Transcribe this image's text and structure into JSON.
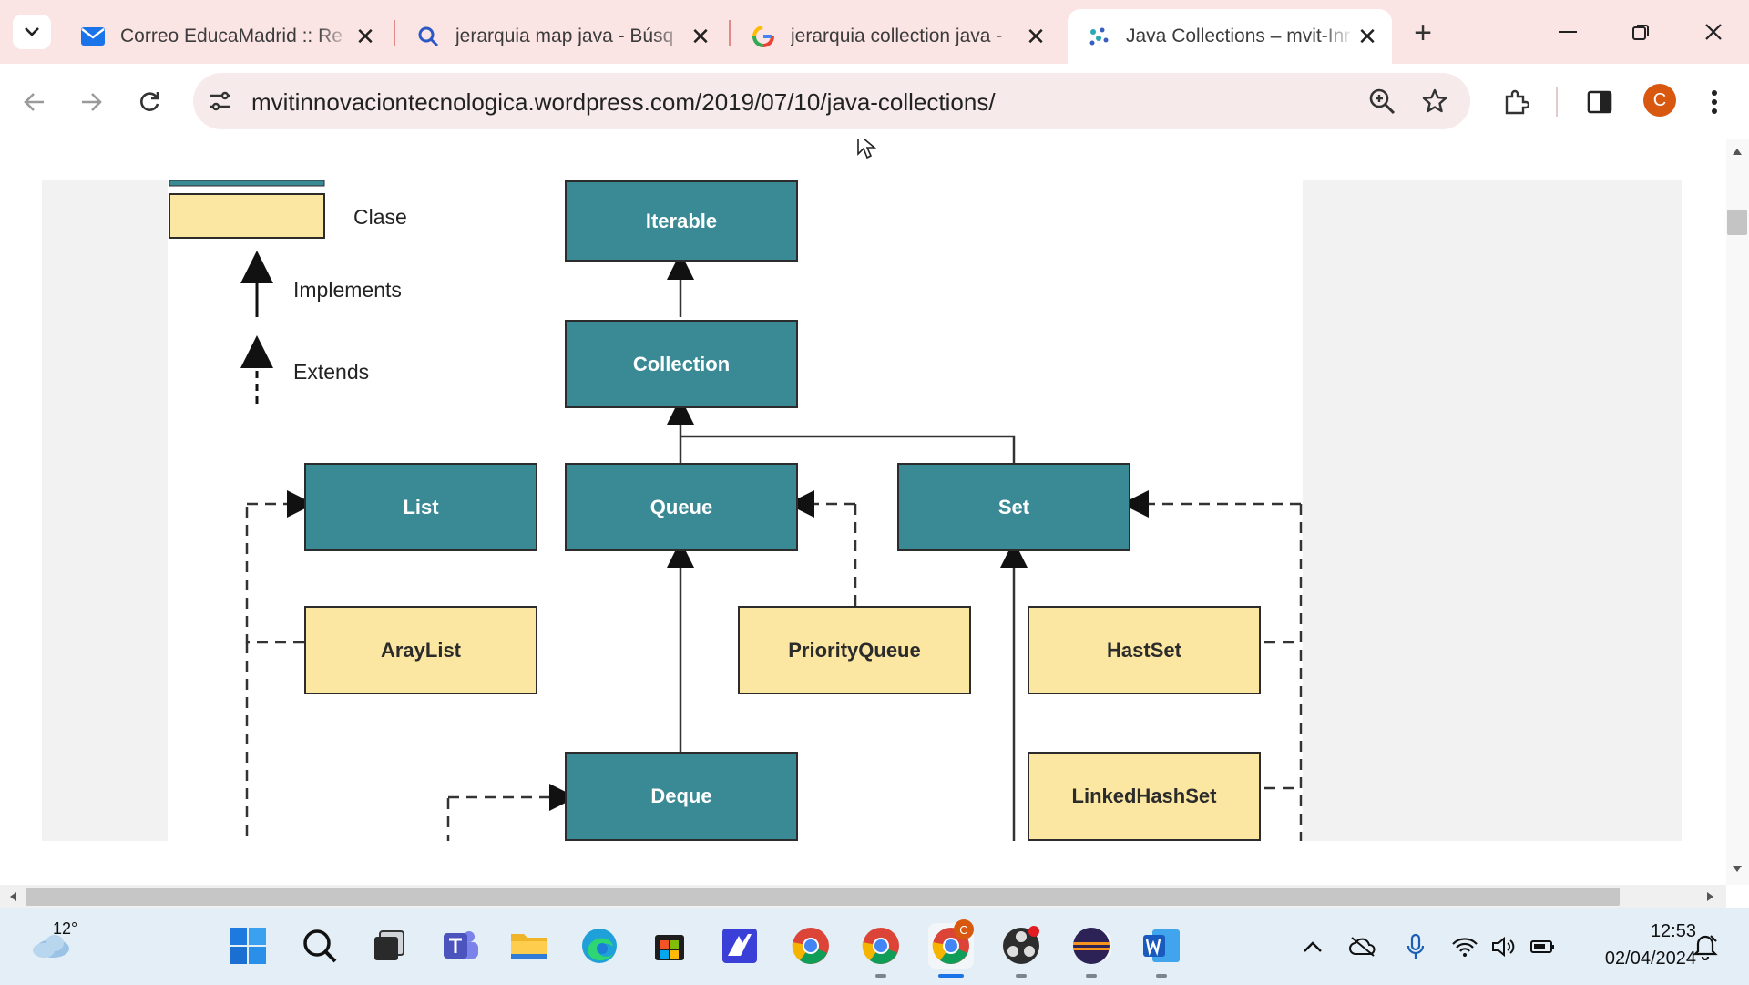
{
  "browser": {
    "tabs": [
      {
        "title": "Correo EducaMadrid :: Re",
        "icon": "gmail-like-mail-icon",
        "active": false
      },
      {
        "title": "jerarquia map java - Búsq",
        "icon": "search-icon",
        "active": false
      },
      {
        "title": "jerarquia collection java - ",
        "icon": "google-icon",
        "active": false
      },
      {
        "title": "Java Collections – mvit-Inr",
        "icon": "wordpress-site-icon",
        "active": true
      }
    ],
    "new_tab_label": "+",
    "url": "mvitinnovaciontecnologica.wordpress.com/2019/07/10/java-collections/",
    "profile_initial": "C"
  },
  "diagram": {
    "legend": {
      "class_label": "Clase",
      "implements_label": "Implements",
      "extends_label": "Extends"
    },
    "nodes": {
      "iterable": "Iterable",
      "collection": "Collection",
      "list": "List",
      "queue": "Queue",
      "set": "Set",
      "deque": "Deque",
      "arraylist": "ArayList",
      "priorityqueue": "PriorityQueue",
      "hashset": "HastSet",
      "linkedhashset": "LinkedHashSet"
    },
    "colors": {
      "interface": "#3a8a96",
      "class": "#fbe7a1"
    }
  },
  "taskbar": {
    "weather_temp": "12°",
    "time": "12:53",
    "date": "02/04/2024",
    "chrome_badge": "C",
    "apps": [
      "windows-start-icon",
      "search-icon",
      "task-view-icon",
      "teams-icon",
      "file-explorer-icon",
      "edge-icon",
      "store-icon",
      "app-icon",
      "chrome-icon",
      "chrome-icon",
      "chrome-profile-icon",
      "obs-icon",
      "eclipse-icon",
      "word-icon"
    ]
  }
}
